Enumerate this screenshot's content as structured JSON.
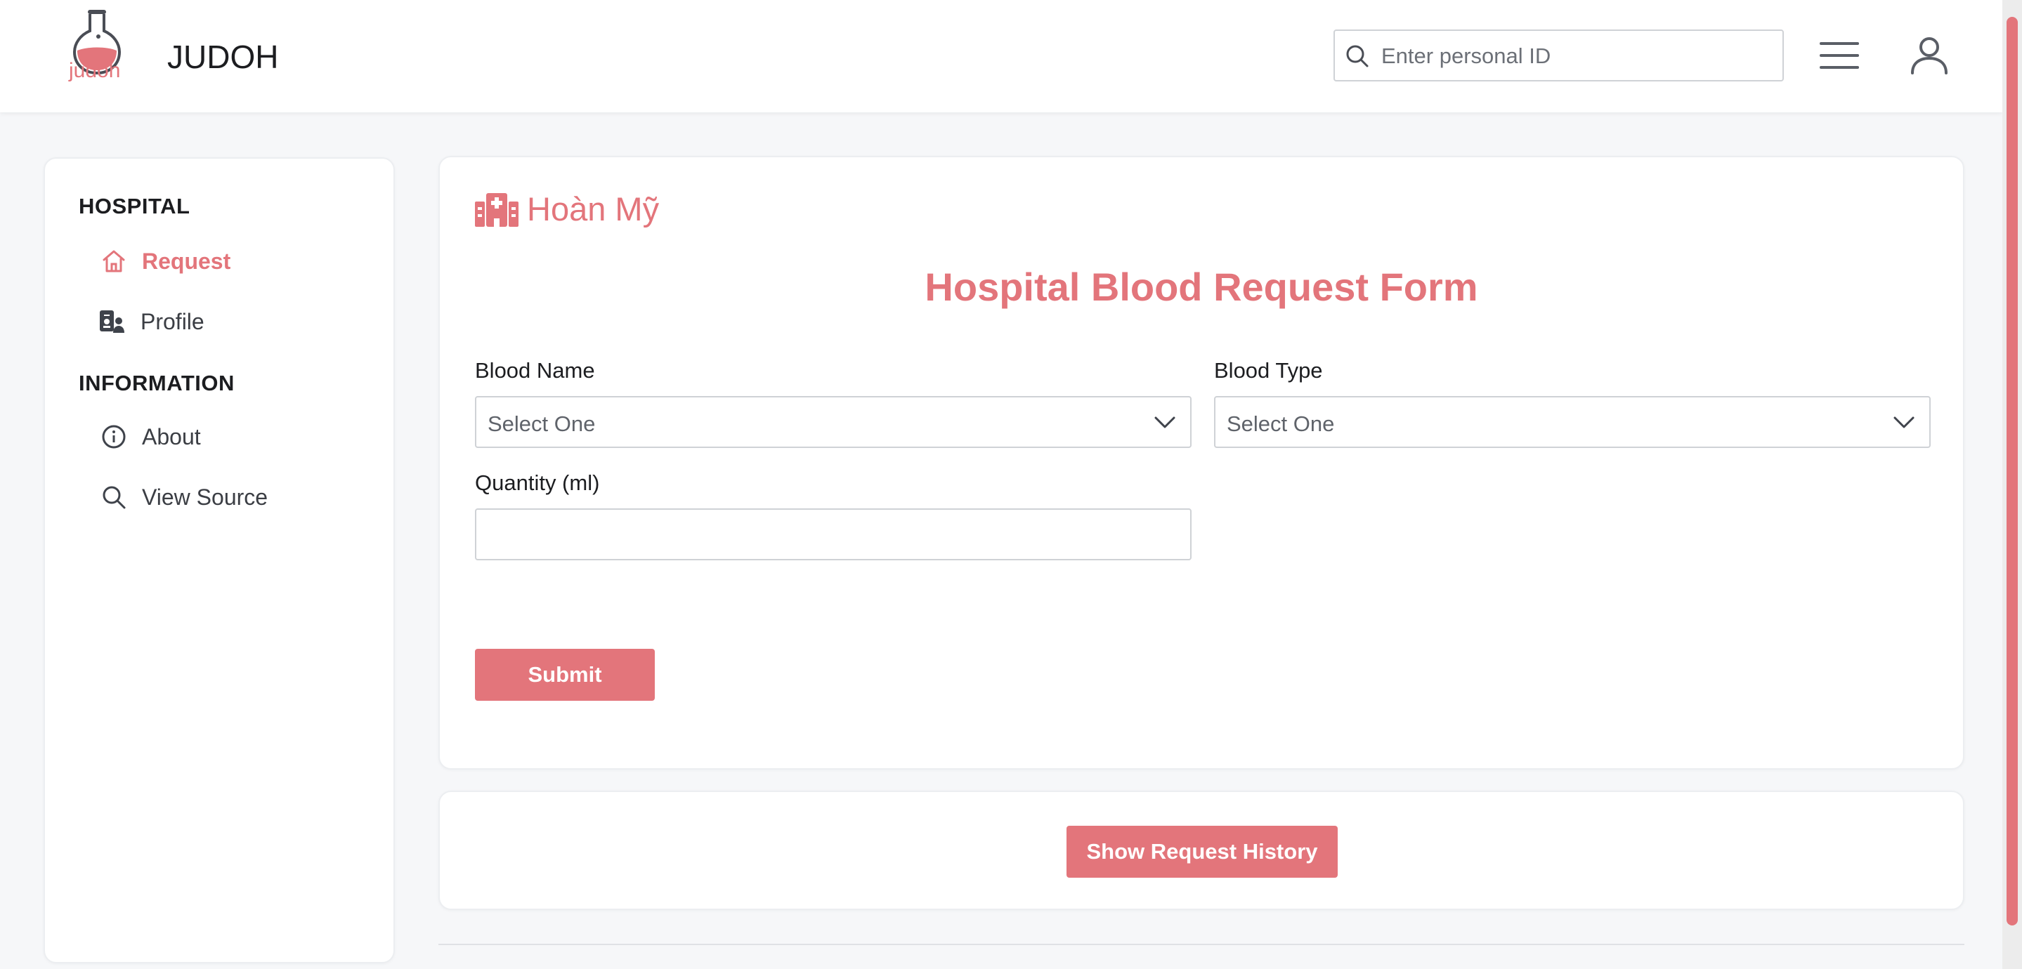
{
  "app": {
    "logo_text": "judoh",
    "title": "JUDOH",
    "brand_color": "#e3757b"
  },
  "header": {
    "search_placeholder": "Enter personal ID",
    "search_icon": "search-icon",
    "menu_icon": "hamburger-menu-icon",
    "user_icon": "user-account-icon"
  },
  "sidebar": {
    "sections": [
      {
        "title": "HOSPITAL",
        "items": [
          {
            "label": "Request",
            "icon": "home-icon",
            "active": true
          },
          {
            "label": "Profile",
            "icon": "id-card-icon",
            "active": false
          }
        ]
      },
      {
        "title": "INFORMATION",
        "items": [
          {
            "label": "About",
            "icon": "info-circle-icon",
            "active": false
          },
          {
            "label": "View Source",
            "icon": "search-icon",
            "active": false
          }
        ]
      }
    ]
  },
  "form": {
    "hospital_name": "Hoàn Mỹ",
    "hospital_icon": "hospital-icon",
    "title": "Hospital Blood Request Form",
    "blood_name": {
      "label": "Blood Name",
      "value": "Select One"
    },
    "blood_type": {
      "label": "Blood Type",
      "value": "Select One"
    },
    "quantity": {
      "label": "Quantity (ml)",
      "value": ""
    },
    "submit_label": "Submit"
  },
  "history": {
    "button_label": "Show Request History"
  }
}
